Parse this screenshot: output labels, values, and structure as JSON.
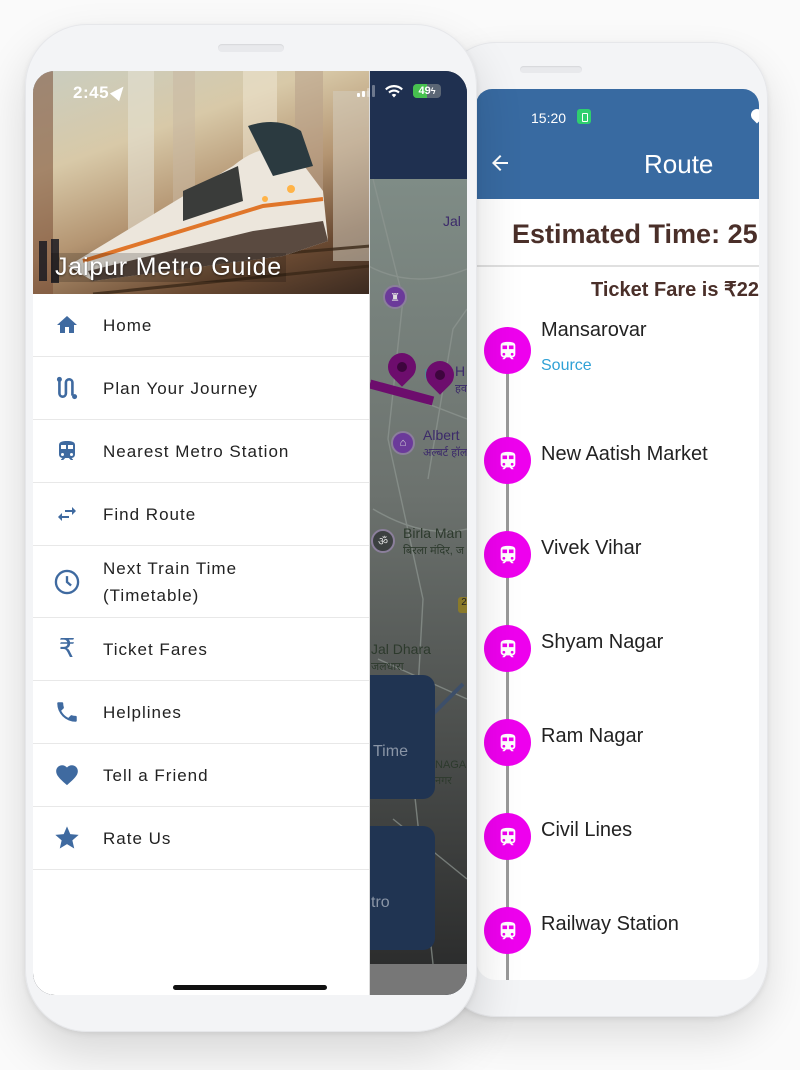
{
  "front_phone": {
    "status_bar": {
      "time": "2:45",
      "battery_level": "49",
      "battery_percent_fill": 49
    },
    "drawer": {
      "title": "Jaipur Metro Guide",
      "items": [
        {
          "label": "Home",
          "icon": "home-icon"
        },
        {
          "label": "Plan Your Journey",
          "icon": "route-icon"
        },
        {
          "label": "Nearest Metro Station",
          "icon": "train-icon"
        },
        {
          "label": "Find Route",
          "icon": "swap-arrows-icon"
        },
        {
          "label": "Next Train Time\n(Timetable)",
          "icon": "clock-icon"
        },
        {
          "label": "Ticket Fares",
          "icon": "rupee-icon"
        },
        {
          "label": "Helplines",
          "icon": "phone-icon"
        },
        {
          "label": "Tell a Friend",
          "icon": "heart-icon"
        },
        {
          "label": "Rate Us",
          "icon": "star-icon"
        }
      ]
    },
    "background_map": {
      "labels": [
        {
          "name": "Jal",
          "sub": ""
        },
        {
          "name": "H",
          "sub": "हव"
        },
        {
          "name": "Albert",
          "sub": "अल्बर्ट हॉल"
        },
        {
          "name": "Birla Man",
          "sub": "बिरला मंदिर, ज"
        },
        {
          "name": "Jal Dhara",
          "sub": "जलधारा"
        },
        {
          "name": "NAGAR",
          "sub": "नगर"
        }
      ],
      "road_badge": "2",
      "cards": [
        {
          "label": "Time"
        },
        {
          "label": "tro"
        }
      ]
    }
  },
  "back_phone": {
    "status_bar": {
      "time": "15:20"
    },
    "appbar": {
      "title": "Route",
      "back_icon": "arrow-left-icon"
    },
    "estimated_time": "Estimated Time: 25",
    "ticket_fare": "Ticket Fare is ₹22",
    "stations": [
      {
        "name": "Mansarovar",
        "tag": "Source"
      },
      {
        "name": "New Aatish Market"
      },
      {
        "name": "Vivek Vihar"
      },
      {
        "name": "Shyam Nagar"
      },
      {
        "name": "Ram Nagar"
      },
      {
        "name": "Civil Lines"
      },
      {
        "name": "Railway Station"
      }
    ],
    "colors": {
      "appbar": "#386aa1",
      "station_dot": "#ee00ee",
      "source_tag": "#2fa1d6",
      "header_text": "#4a2f29"
    }
  },
  "colors": {
    "drawer_icon": "#3f6aa0"
  }
}
